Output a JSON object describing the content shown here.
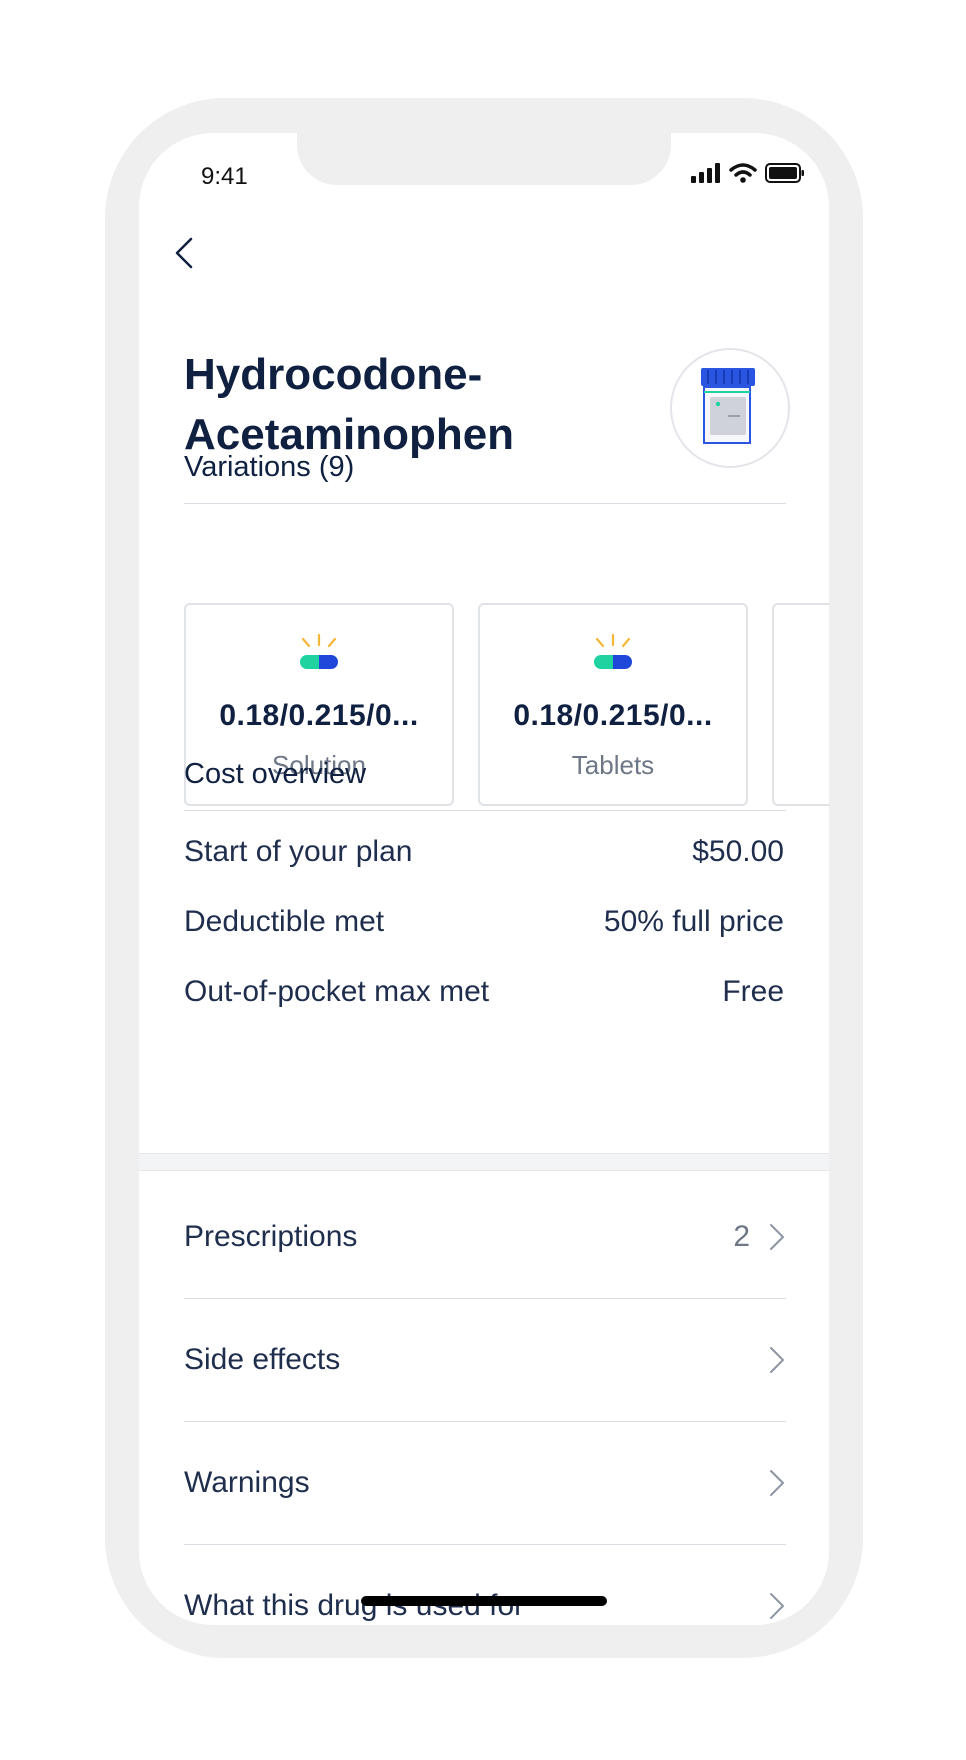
{
  "status_bar": {
    "time": "9:41"
  },
  "drug": {
    "name": "Hydrocodone-Acetaminophen"
  },
  "variations": {
    "label": "Variations (9)",
    "items": [
      {
        "strength": "0.18/0.215/0...",
        "form": "Solution"
      },
      {
        "strength": "0.18/0.215/0...",
        "form": "Tablets"
      }
    ]
  },
  "cost_overview": {
    "label": "Cost overview",
    "rows": [
      {
        "label": "Start of your plan",
        "value": "$50.00"
      },
      {
        "label": "Deductible met",
        "value": "50% full price"
      },
      {
        "label": "Out-of-pocket max met",
        "value": "Free"
      }
    ]
  },
  "nav": [
    {
      "label": "Prescriptions",
      "count": "2"
    },
    {
      "label": "Side effects"
    },
    {
      "label": "Warnings"
    },
    {
      "label": "What this drug is used for"
    }
  ],
  "colors": {
    "accent_blue": "#1f47d9",
    "accent_green": "#1fd3a0",
    "spark_yellow": "#f5b73a",
    "text_dark": "#0f2040"
  }
}
